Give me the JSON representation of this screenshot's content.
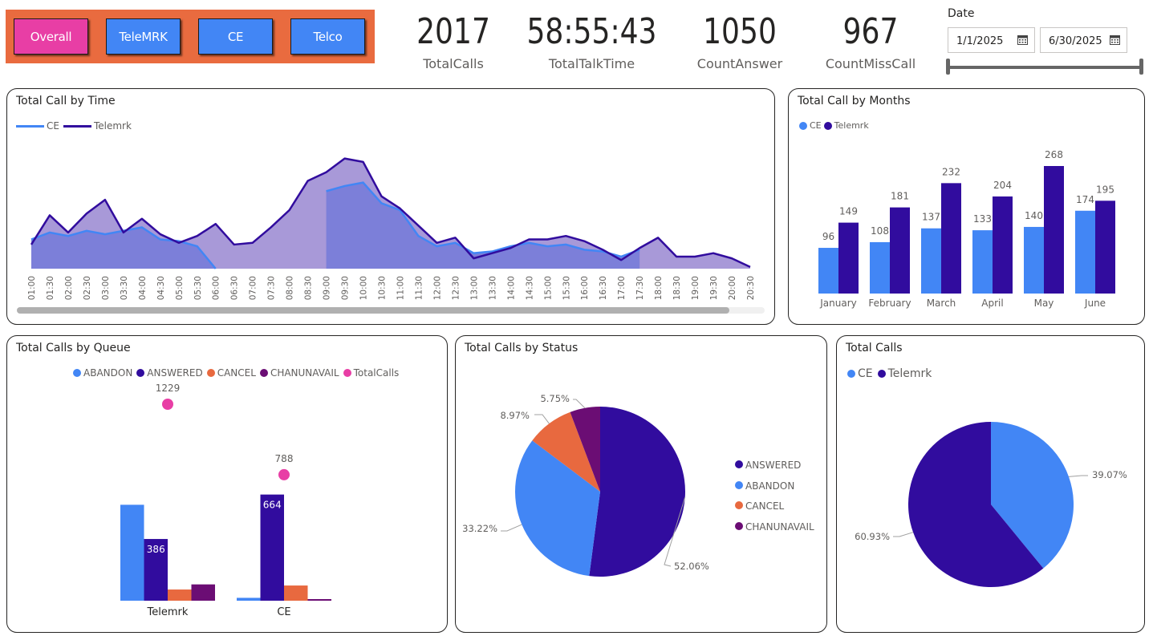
{
  "nav": {
    "buttons": [
      {
        "label": "Overall",
        "color": "#e83ea5"
      },
      {
        "label": "TeleMRK",
        "color": "#4286f5"
      },
      {
        "label": "CE",
        "color": "#4286f5"
      },
      {
        "label": "Telco",
        "color": "#4286f5"
      }
    ]
  },
  "kpis": [
    {
      "value": "2017",
      "label": "TotalCalls"
    },
    {
      "value": "58:55:43",
      "label": "TotalTalkTime"
    },
    {
      "value": "1050",
      "label": "CountAnswer"
    },
    {
      "value": "967",
      "label": "CountMissCall"
    }
  ],
  "date": {
    "label": "Date",
    "start": "1/1/2025",
    "end": "6/30/2025",
    "icon": "calendar-icon"
  },
  "colors": {
    "ce": "#4286f5",
    "telemrk": "#310c9e",
    "cancel": "#e8693f",
    "chanunavail": "#6b0d74",
    "totalcalls": "#e83ea5"
  },
  "cards": {
    "time": {
      "title": "Total Call by Time",
      "chart_data": {
        "type": "area",
        "x": [
          "01:00",
          "01:30",
          "02:00",
          "02:30",
          "03:00",
          "03:30",
          "04:00",
          "04:30",
          "05:00",
          "05:30",
          "06:00",
          "06:30",
          "07:00",
          "07:30",
          "08:00",
          "08:30",
          "09:00",
          "09:30",
          "10:00",
          "10:30",
          "11:00",
          "11:30",
          "12:00",
          "12:30",
          "13:00",
          "13:30",
          "14:00",
          "14:30",
          "15:00",
          "15:30",
          "16:00",
          "16:30",
          "17:00",
          "17:30",
          "18:00",
          "18:30",
          "19:00",
          "19:30",
          "20:00",
          "20:30"
        ],
        "series": [
          {
            "name": "CE",
            "values": [
              17,
              21,
              19,
              22,
              20,
              22,
              24,
              17,
              16,
              13,
              0,
              null,
              null,
              null,
              null,
              null,
              45,
              48,
              50,
              38,
              34,
              19,
              13,
              15,
              9,
              10,
              13,
              15,
              13,
              14,
              11,
              10,
              7,
              11,
              null,
              null,
              null,
              null,
              null,
              null
            ]
          },
          {
            "name": "Telemrk",
            "values": [
              14,
              31,
              21,
              32,
              40,
              21,
              29,
              20,
              15,
              19,
              26,
              14,
              15,
              24,
              34,
              51,
              56,
              64,
              62,
              42,
              35,
              25,
              15,
              18,
              6,
              9,
              12,
              17,
              17,
              19,
              16,
              11,
              5,
              12,
              18,
              7,
              7,
              9,
              6,
              1
            ]
          }
        ]
      }
    },
    "months": {
      "title": "Total Call by Months",
      "chart_data": {
        "type": "bar",
        "categories": [
          "January",
          "February",
          "March",
          "April",
          "May",
          "June"
        ],
        "series": [
          {
            "name": "CE",
            "values": [
              96,
              108,
              137,
              133,
              140,
              174
            ]
          },
          {
            "name": "Telemrk",
            "values": [
              149,
              181,
              232,
              204,
              268,
              195
            ]
          }
        ],
        "ylim": [
          0,
          310
        ]
      }
    },
    "queue": {
      "title": "Total Calls by Queue",
      "chart_data": {
        "type": "bar",
        "categories": [
          "Telemrk",
          "CE"
        ],
        "series": [
          {
            "name": "ABANDON",
            "values": [
              600,
              18
            ]
          },
          {
            "name": "ANSWERED",
            "values": [
              386,
              664
            ]
          },
          {
            "name": "CANCEL",
            "values": [
              70,
              95
            ]
          },
          {
            "name": "CHANUNAVAIL",
            "values": [
              102,
              6
            ]
          },
          {
            "name": "TotalCalls",
            "values": [
              1229,
              788
            ]
          }
        ],
        "ylim": [
          0,
          1250
        ]
      }
    },
    "status": {
      "title": "Total Calls by Status",
      "chart_data": {
        "type": "pie",
        "labels": [
          "ANSWERED",
          "ABANDON",
          "CANCEL",
          "CHANUNAVAIL"
        ],
        "values": [
          52.06,
          33.22,
          8.97,
          5.75
        ],
        "value_labels": [
          "52.06%",
          "33.22%",
          "8.97%",
          "5.75%"
        ]
      }
    },
    "total": {
      "title": "Total Calls",
      "chart_data": {
        "type": "pie",
        "labels": [
          "CE",
          "Telemrk"
        ],
        "values": [
          39.07,
          60.93
        ],
        "value_labels": [
          "39.07%",
          "60.93%"
        ]
      }
    }
  }
}
